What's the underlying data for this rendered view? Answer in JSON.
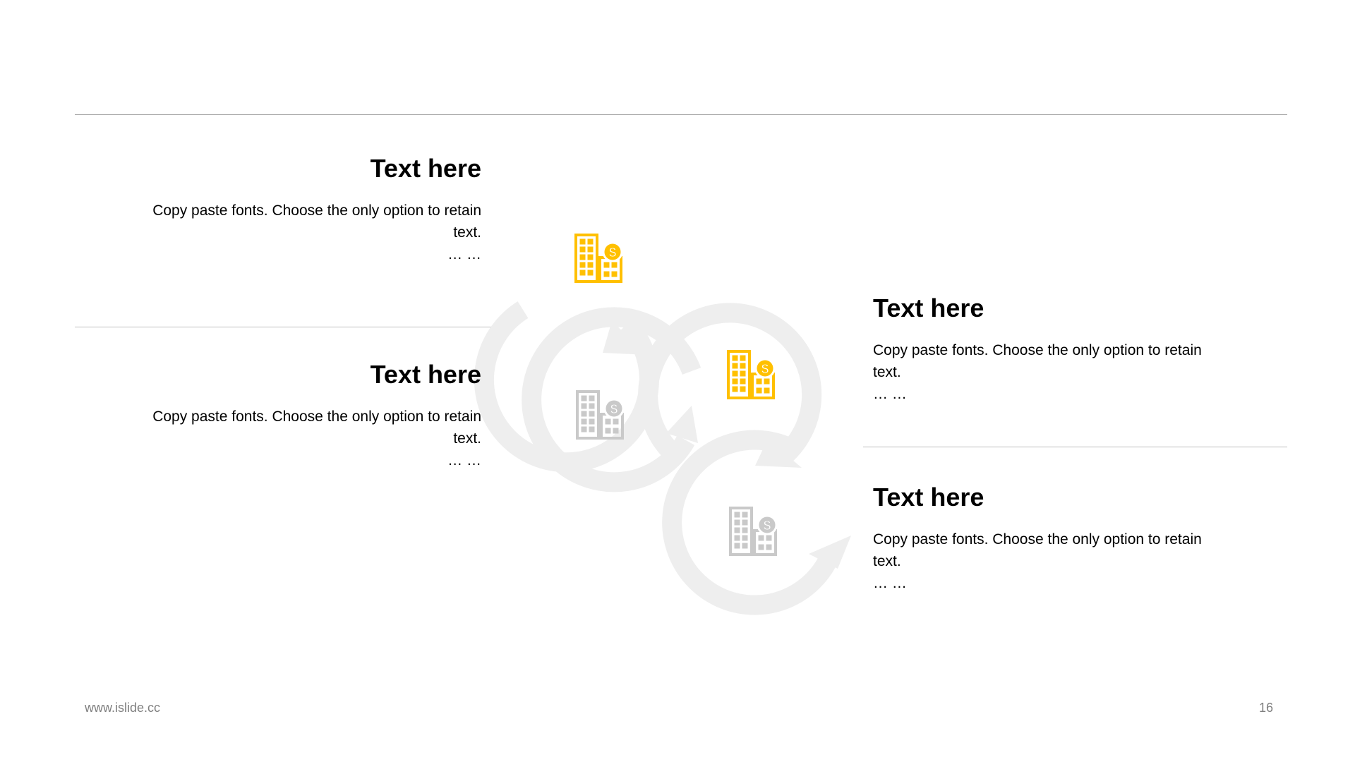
{
  "blocks": [
    {
      "title": "Text here",
      "body": "Copy paste fonts. Choose the only option to retain text.",
      "ellipsis": "… …"
    },
    {
      "title": "Text here",
      "body": "Copy paste fonts. Choose the only option to retain text.",
      "ellipsis": "… …"
    },
    {
      "title": "Text here",
      "body": "Copy paste fonts. Choose the only option to retain text.",
      "ellipsis": "… …"
    },
    {
      "title": "Text here",
      "body": "Copy paste fonts. Choose the only option to retain text.",
      "ellipsis": "… …"
    }
  ],
  "icons": [
    {
      "name": "building-dollar-icon",
      "state": "active"
    },
    {
      "name": "building-dollar-icon",
      "state": "inactive"
    },
    {
      "name": "building-dollar-icon",
      "state": "active"
    },
    {
      "name": "building-dollar-icon",
      "state": "inactive"
    }
  ],
  "colors": {
    "accent": "#FFC000",
    "inactive_icon": "#C9C9C9",
    "ring": "#EEEEEE",
    "divider": "#BDBDBD",
    "footer_text": "#7F7F7F"
  },
  "footer": {
    "url": "www.islide.cc",
    "page": "16"
  }
}
